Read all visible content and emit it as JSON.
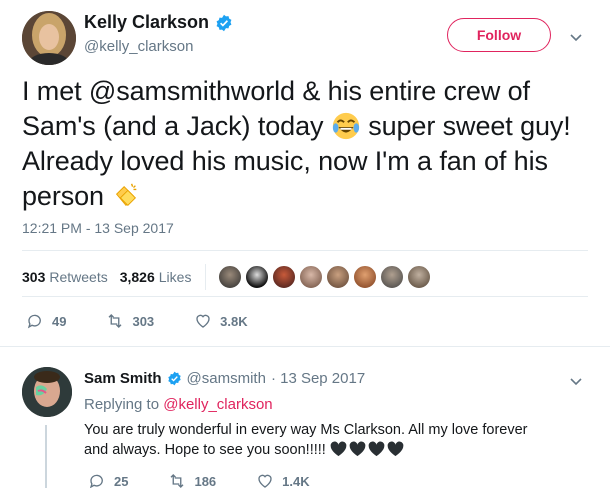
{
  "tweet": {
    "author_name": "Kelly Clarkson",
    "author_handle": "@kelly_clarkson",
    "follow_label": "Follow",
    "text_part1": "I met @samsmithworld & his entire crew of Sam's (and a Jack) today ",
    "text_part2": " super sweet guy! Already loved his music, now I'm a fan of his person ",
    "timestamp": "12:21 PM - 13 Sep 2017",
    "retweets_count": "303",
    "retweets_label": "Retweets",
    "likes_count": "3,826",
    "likes_label": "Likes",
    "actions": {
      "reply_count": "49",
      "retweet_count": "303",
      "like_count": "3.8K"
    }
  },
  "reply": {
    "author_name": "Sam Smith",
    "author_handle": "@samsmith",
    "date": "· 13 Sep 2017",
    "replying_prefix": "Replying to",
    "replying_to": "@kelly_clarkson",
    "text": "You are truly wonderful in every way Ms Clarkson. All my love forever and always. Hope to see you soon!!!!!",
    "actions": {
      "reply_count": "25",
      "retweet_count": "186",
      "like_count": "1.4K"
    }
  },
  "colors": {
    "accent": "#e0245e",
    "verified": "#1da1f2",
    "muted": "#657786"
  },
  "icons": [
    "verified-icon",
    "chevron-down-icon",
    "joy-emoji-icon",
    "clap-emoji-icon",
    "reply-icon",
    "retweet-icon",
    "heart-icon",
    "black-heart-icon"
  ]
}
